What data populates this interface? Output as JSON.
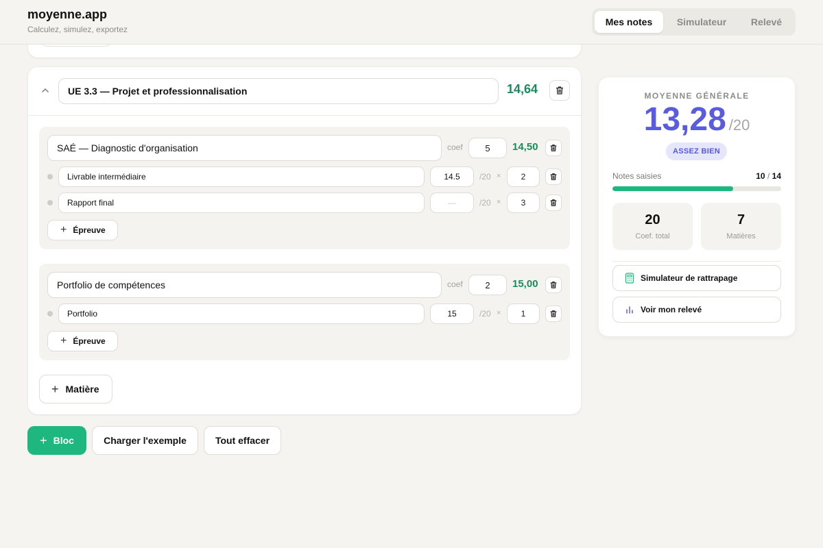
{
  "app": {
    "title": "moyenne.app",
    "subtitle": "Calculez, simulez, exportez"
  },
  "tabs": [
    {
      "label": "Mes notes",
      "active": true
    },
    {
      "label": "Simulateur",
      "active": false
    },
    {
      "label": "Relevé",
      "active": false
    }
  ],
  "ue": {
    "name": "UE 3.3 — Projet et professionnalisation",
    "average": "14,64",
    "matieres": [
      {
        "name": "SAÉ — Diagnostic d'organisation",
        "coef_label": "coef",
        "coef": "5",
        "average": "14,50",
        "epreuves": [
          {
            "name": "Livrable intermédiaire",
            "grade": "14.5",
            "grade_placeholder": "—",
            "out_of": "/20",
            "times": "×",
            "coef": "2"
          },
          {
            "name": "Rapport final",
            "grade": "",
            "grade_placeholder": "—",
            "out_of": "/20",
            "times": "×",
            "coef": "3"
          }
        ],
        "add_epreuve_label": "Épreuve"
      },
      {
        "name": "Portfolio de compétences",
        "coef_label": "coef",
        "coef": "2",
        "average": "15,00",
        "epreuves": [
          {
            "name": "Portfolio",
            "grade": "15",
            "grade_placeholder": "—",
            "out_of": "/20",
            "times": "×",
            "coef": "1"
          }
        ],
        "add_epreuve_label": "Épreuve"
      }
    ],
    "add_matiere_label": "Matière"
  },
  "actions": {
    "add_bloc": "Bloc",
    "load_example": "Charger l'exemple",
    "clear_all": "Tout effacer"
  },
  "summary": {
    "label": "MOYENNE GÉNÉRALE",
    "average": "13,28",
    "out_of": "/20",
    "mention": "ASSEZ BIEN",
    "notes_label": "Notes saisies",
    "notes_entered": "10",
    "notes_sep": "/",
    "notes_total": "14",
    "progress_fraction": 0.714,
    "coef_total": "20",
    "coef_total_label": "Coef. total",
    "matieres_count": "7",
    "matieres_label": "Matières",
    "simulator_button": "Simulateur de rattrapage",
    "releve_button": "Voir mon relevé"
  },
  "colors": {
    "accent_green": "#1db77f",
    "grade_green": "#1a8c5b",
    "average_purple": "#5a5ce0",
    "badge_bg": "#e6e6fb"
  },
  "icons": {
    "collapse": "chevron-up-icon",
    "delete": "trash-icon",
    "add": "plus-icon",
    "simulator": "calculator-icon",
    "releve": "bar-chart-icon"
  }
}
